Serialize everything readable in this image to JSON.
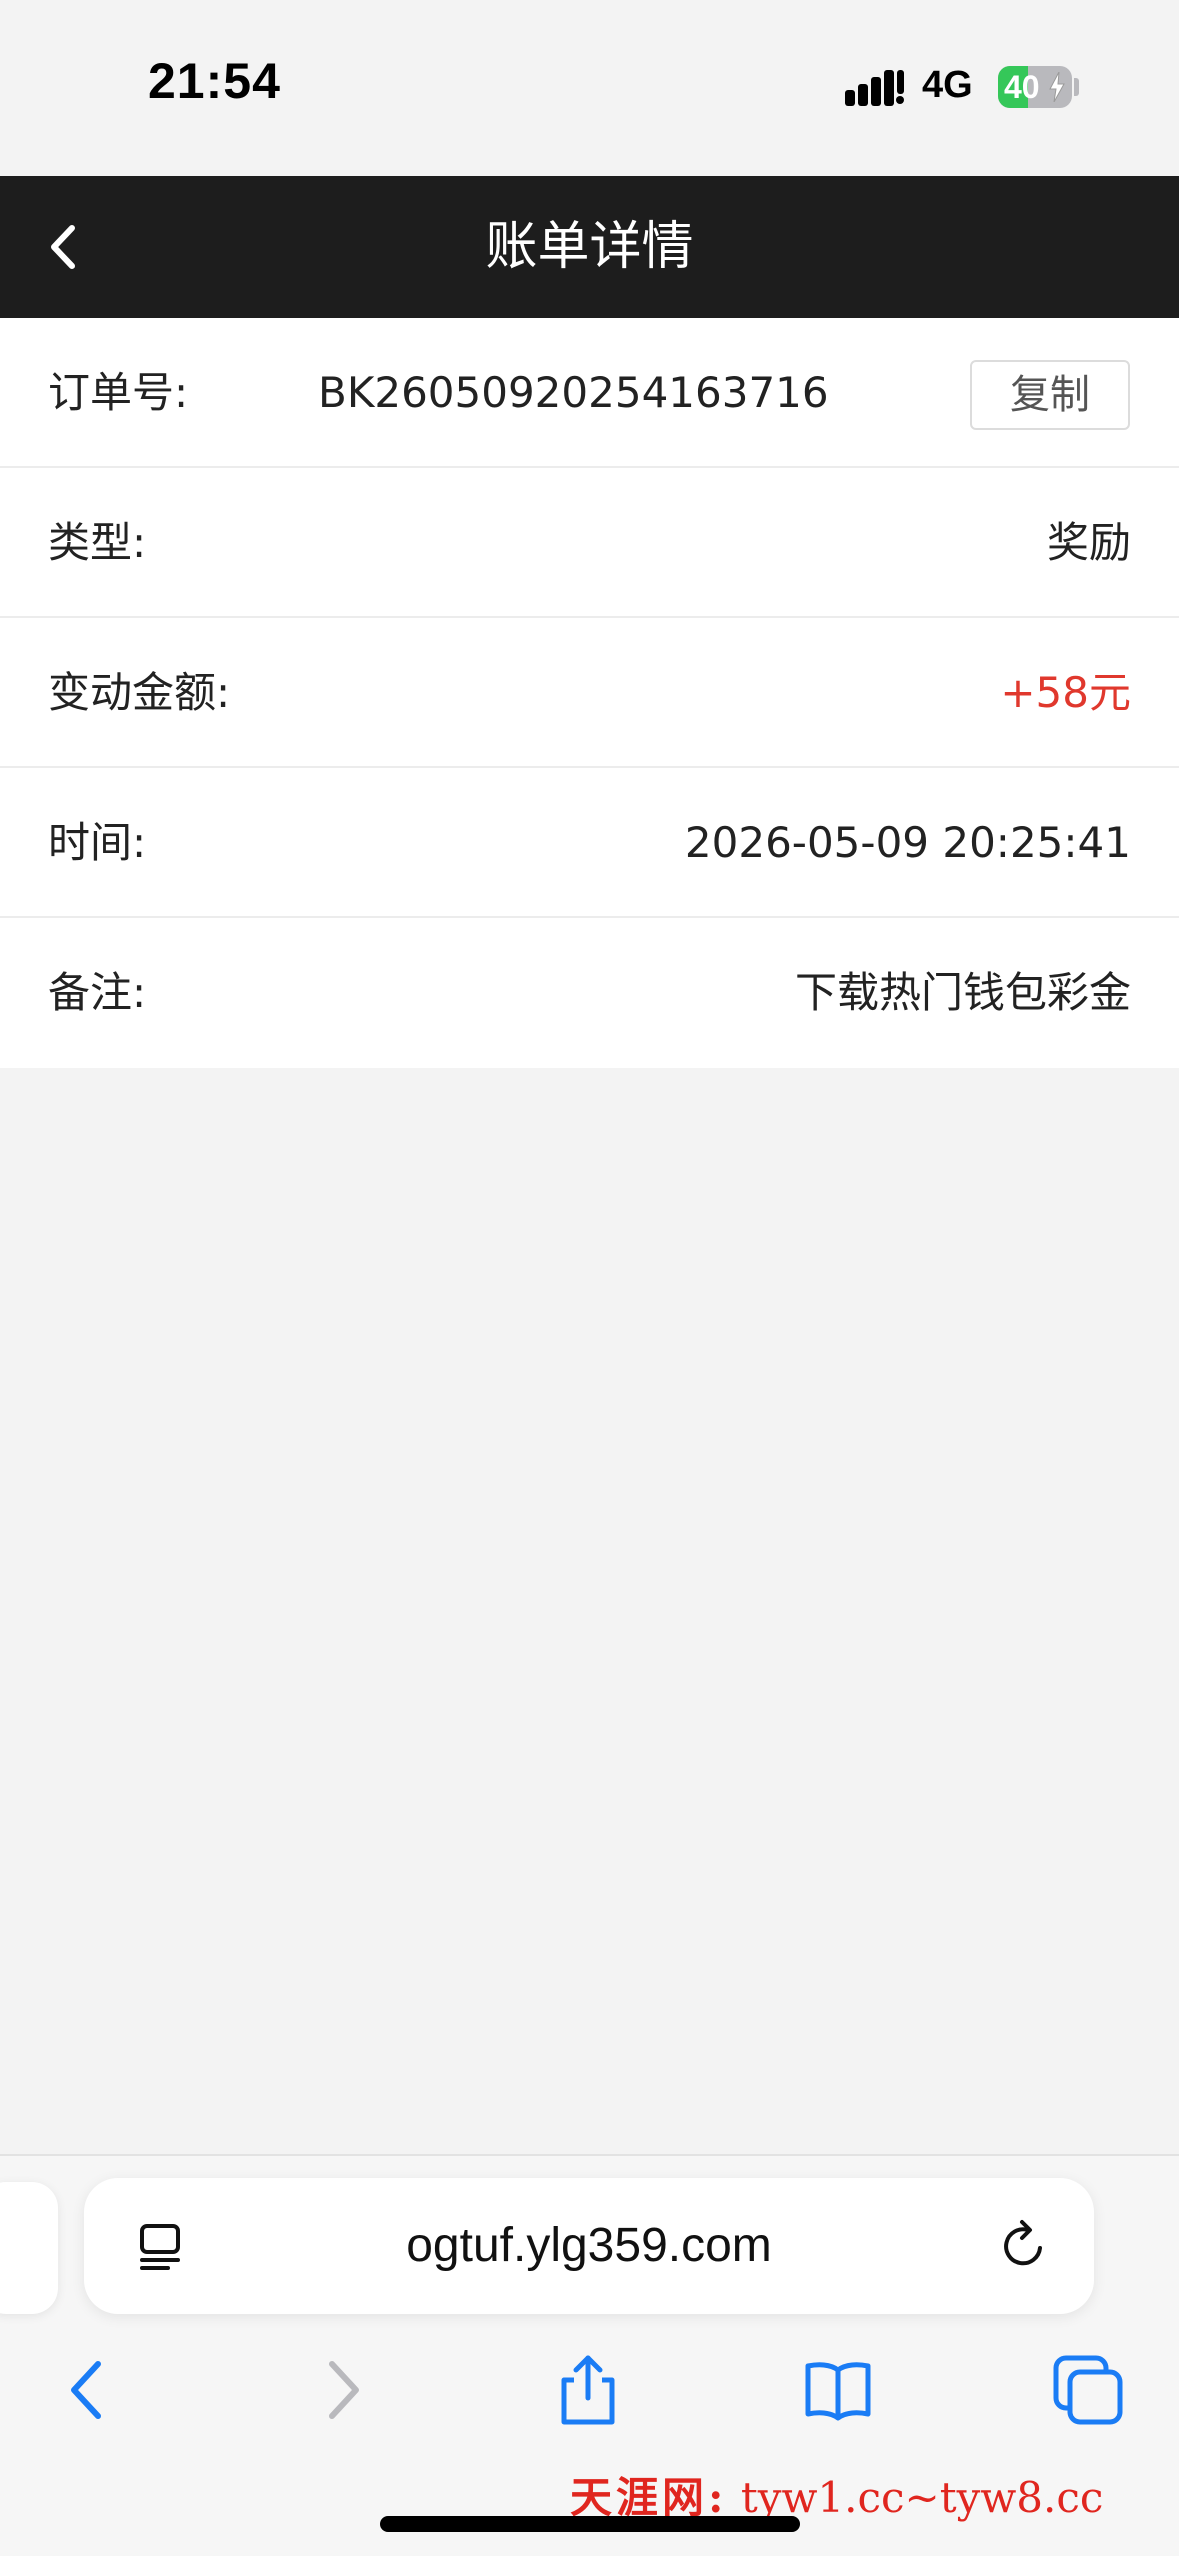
{
  "status_bar": {
    "time": "21:54",
    "network": "4G",
    "battery_level": "40",
    "battery_fraction": 0.4,
    "battery_color": "#35c759"
  },
  "nav": {
    "title": "账单详情",
    "back_icon": "chevron-left-icon"
  },
  "details": {
    "order": {
      "label": "订单号:",
      "value": "BK2605092025416371​6",
      "copy_label": "复制"
    },
    "type": {
      "label": "类型:",
      "value": "奖励"
    },
    "amount": {
      "label": "变动金额:",
      "value": "+58元",
      "color": "#e0382d"
    },
    "time": {
      "label": "时间:",
      "value": "2026-05-09 20:25:41"
    },
    "note": {
      "label": "备注:",
      "value": "下载热门钱包彩金"
    }
  },
  "browser": {
    "url": "ogtuf.ylg359.com",
    "accent": "#1a7cf5",
    "icons": [
      "reader-icon",
      "reload-icon",
      "back-icon",
      "forward-icon",
      "share-icon",
      "bookmarks-icon",
      "tabs-icon"
    ]
  },
  "watermark": {
    "cn": "天涯网:",
    "url": "tyw1.cc~tyw8.cc"
  }
}
